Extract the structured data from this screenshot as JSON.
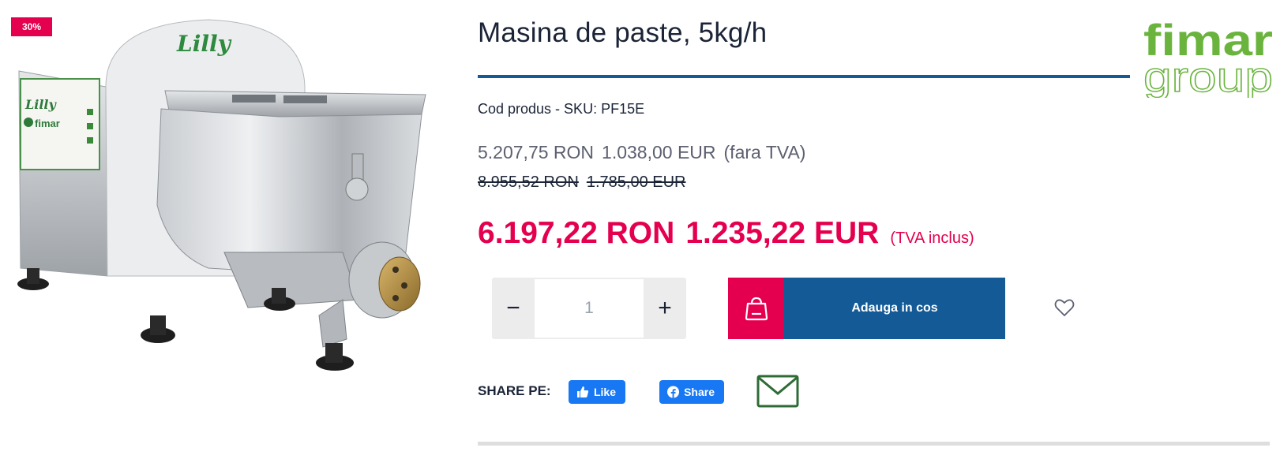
{
  "badge": {
    "discount": "30%"
  },
  "image": {
    "brand_on_machine": "Lilly",
    "brand_on_panel": "fimar"
  },
  "product": {
    "title": "Masina de paste, 5kg/h",
    "sku_label": "Cod produs - SKU: PF15E"
  },
  "logo": {
    "word_top": "fimar",
    "word_bottom": "group"
  },
  "prices": {
    "net_ron": "5.207,75 RON",
    "net_eur": "1.038,00 EUR",
    "net_note": "(fara TVA)",
    "old_ron": "8.955,52 RON",
    "old_eur": "1.785,00 EUR",
    "final_ron": "6.197,22 RON",
    "final_eur": "1.235,22 EUR",
    "final_note": "(TVA inclus)"
  },
  "quantity": {
    "minus": "−",
    "value": "1",
    "plus": "+"
  },
  "cart": {
    "button_label": "Adauga in cos"
  },
  "share": {
    "label": "SHARE PE:",
    "like_label": "Like",
    "share_label": "Share"
  },
  "icons": {
    "cart": "shopping-bag-icon",
    "wishlist": "heart-icon",
    "email": "envelope-icon",
    "like": "thumbs-up-icon",
    "facebook": "facebook-icon"
  },
  "colors": {
    "accent_pink": "#e4004f",
    "brand_blue": "#135a96",
    "facebook_blue": "#1877f2",
    "logo_green": "#6ab43e",
    "mail_green": "#2f6b35"
  }
}
